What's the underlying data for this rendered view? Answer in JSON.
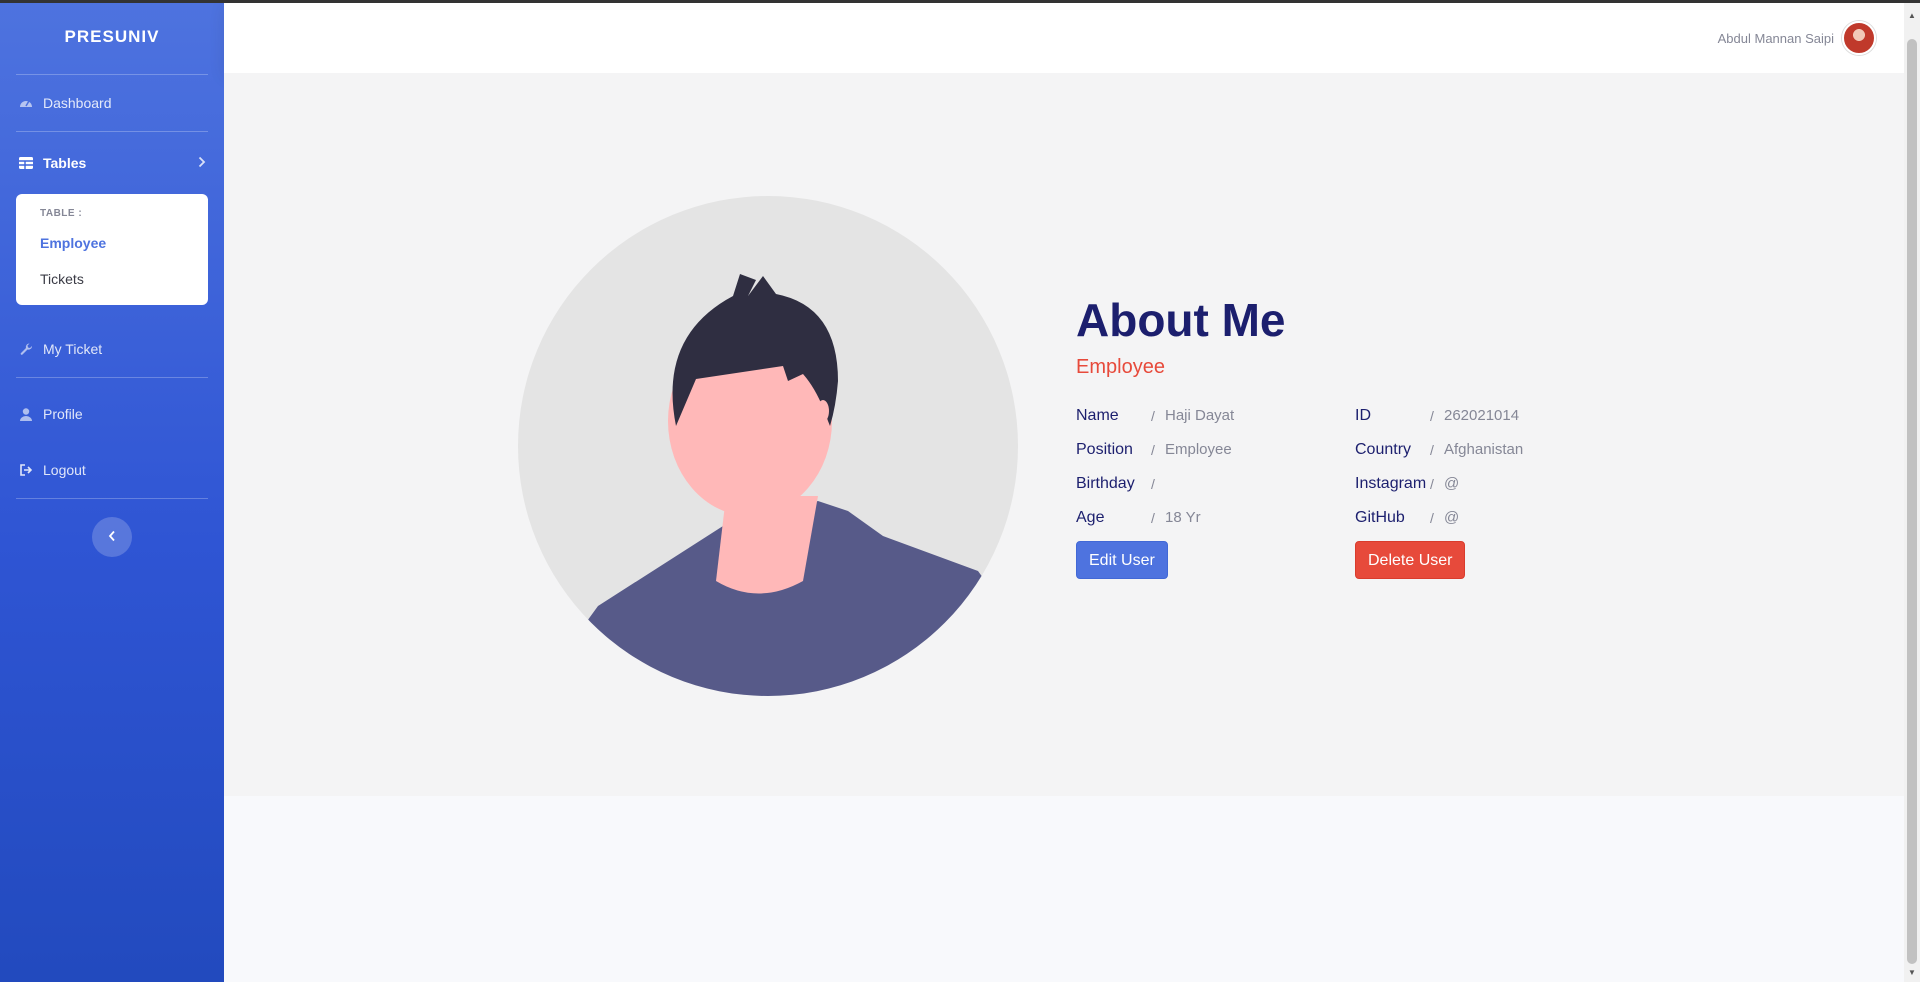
{
  "sidebar": {
    "brand": "PRESUNIV",
    "items": [
      {
        "label": "Dashboard",
        "icon": "tachometer-icon"
      },
      {
        "label": "Tables",
        "icon": "table-icon"
      },
      {
        "label": "My Ticket",
        "icon": "wrench-icon"
      },
      {
        "label": "Profile",
        "icon": "user-icon"
      },
      {
        "label": "Logout",
        "icon": "sign-out-icon"
      }
    ],
    "collapse": {
      "header": "TABLE :",
      "items": [
        "Employee",
        "Tickets"
      ]
    },
    "toggle_icon": "chevron-left-icon"
  },
  "topbar": {
    "user_name": "Abdul Mannan Saipi"
  },
  "profile": {
    "title": "About Me",
    "role": "Employee",
    "fields_left": [
      {
        "key": "Name",
        "sep": "/",
        "value": "Haji Dayat"
      },
      {
        "key": "Position",
        "sep": "/",
        "value": "Employee"
      },
      {
        "key": "Birthday",
        "sep": "/",
        "value": ""
      },
      {
        "key": "Age",
        "sep": "/",
        "value": "18 Yr"
      }
    ],
    "fields_right": [
      {
        "key": "ID",
        "sep": "/",
        "value": "262021014"
      },
      {
        "key": "Country",
        "sep": "/",
        "value": "Afghanistan"
      },
      {
        "key": "Instagram",
        "sep": "/",
        "value": "@"
      },
      {
        "key": "GitHub",
        "sep": "/",
        "value": "@"
      }
    ],
    "edit_label": "Edit User",
    "delete_label": "Delete User"
  },
  "colors": {
    "primary": "#4e73df",
    "danger": "#e74a3b",
    "heading": "#1c1f6e"
  }
}
